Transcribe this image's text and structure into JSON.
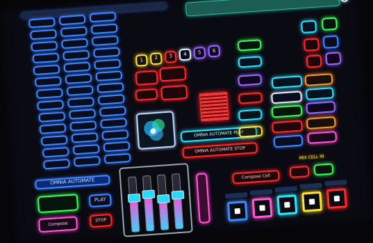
{
  "top": {
    "left_label": "",
    "right_label": "",
    "right_tab": ""
  },
  "left_grid": {
    "buttons": [
      "",
      "",
      "",
      "",
      "",
      "",
      "",
      "",
      "",
      "",
      "",
      "",
      "",
      "",
      "",
      "",
      "",
      "",
      "",
      "",
      "",
      "",
      "",
      "",
      "",
      "",
      "",
      "",
      "",
      "",
      "",
      "",
      "",
      "",
      "",
      "",
      "",
      "",
      ""
    ]
  },
  "center": {
    "title": "",
    "small_labels": [
      "1",
      "2",
      "3",
      "4",
      "5",
      "6"
    ],
    "value_label": "",
    "value_number": "",
    "red_buttons": [
      "",
      "",
      "",
      ""
    ],
    "cyan_wide": "OMNIA AUTOMATE PLAY",
    "red_wide": "OMNIA AUTOMATE STOP"
  },
  "bottom_left": {
    "title": "OMNIA AUTOMATE",
    "play": "PLAY",
    "compose": "Compose",
    "stop": "STOP"
  },
  "right_panel": {
    "column_header": "",
    "mixer_title": "MIX CELL IN",
    "compose_cell": "Compose Cell"
  },
  "mixer": {
    "levels": [
      0.6,
      0.65,
      0.55,
      0.6
    ]
  },
  "colors": {
    "blue": "#3c8bff",
    "red": "#ff2b2b",
    "green": "#3bff5a",
    "yellow": "#ffe33a",
    "cyan": "#2ee6ff",
    "orange": "#ff9a2b",
    "pink": "#ff5bd6",
    "purple": "#9f6bff"
  }
}
